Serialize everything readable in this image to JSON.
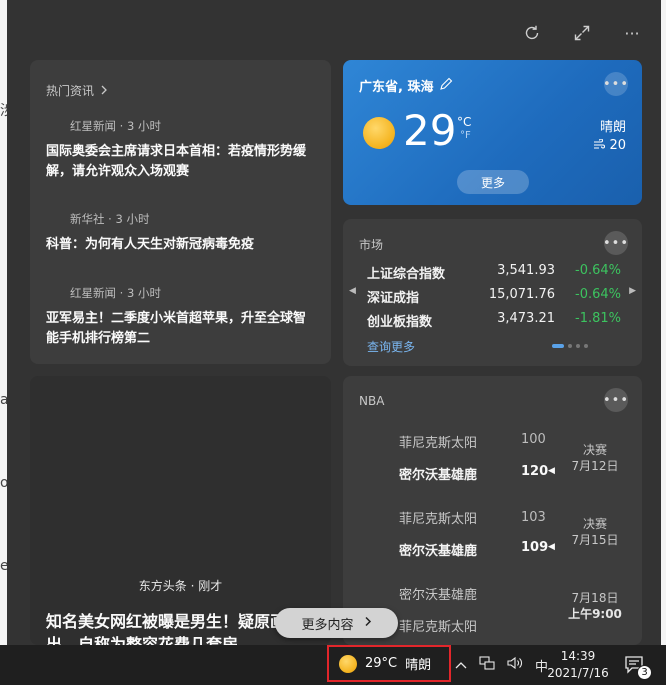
{
  "desktop_fragments": [
    "涉",
    "a",
    "o",
    "e"
  ],
  "toolbar": {
    "refresh_icon": "refresh-icon",
    "expand_icon": "expand-icon",
    "more_label": "···"
  },
  "news": {
    "title": "热门资讯",
    "items": [
      {
        "source": "红星新闻 · 3 小时",
        "headline": "国际奥委会主席请求日本首相：若疫情形势缓解，请允许观众入场观赛"
      },
      {
        "source": "新华社 · 3 小时",
        "headline": "科普：为何有人天生对新冠病毒免疫"
      },
      {
        "source": "红星新闻 · 3 小时",
        "headline": "亚军易主！二季度小米首超苹果，升至全球智能手机排行榜第二"
      }
    ]
  },
  "weather": {
    "location": "广东省, 珠海",
    "temperature": "29",
    "unit_c": "°C",
    "unit_f": "°F",
    "condition": "晴朗",
    "wind": "20",
    "more_label": "更多"
  },
  "market": {
    "title": "市场",
    "rows": [
      {
        "name": "上证综合指数",
        "value": "3,541.93",
        "change": "-0.64%"
      },
      {
        "name": "深证成指",
        "value": "15,071.76",
        "change": "-0.64%"
      },
      {
        "name": "创业板指数",
        "value": "3,473.21",
        "change": "-1.81%"
      }
    ],
    "link": "查询更多",
    "change_color": "#3cc35f"
  },
  "bignews": {
    "source": "东方头条 · 刚才",
    "headline": "知名美女网红被曝是男生！疑原画频流出，自称为整容花费几套房"
  },
  "nba": {
    "title": "NBA",
    "games": [
      {
        "team1": "菲尼克斯太阳",
        "score1": "100",
        "team2": "密尔沃基雄鹿",
        "score2": "120",
        "status1": "决赛",
        "status2": "7月12日"
      },
      {
        "team1": "菲尼克斯太阳",
        "score1": "103",
        "team2": "密尔沃基雄鹿",
        "score2": "109",
        "status1": "决赛",
        "status2": "7月15日"
      },
      {
        "team1": "密尔沃基雄鹿",
        "score1": "",
        "team2": "菲尼克斯太阳",
        "score2": "",
        "status1": "7月18日",
        "status2": "上午9:00"
      }
    ]
  },
  "more_content": "更多内容",
  "taskbar": {
    "weather_temp": "29°C",
    "weather_cond": "晴朗",
    "ime": "中",
    "time": "14:39",
    "date": "2021/7/16",
    "notify_count": "3",
    "highlight_color": "#e2262b"
  }
}
